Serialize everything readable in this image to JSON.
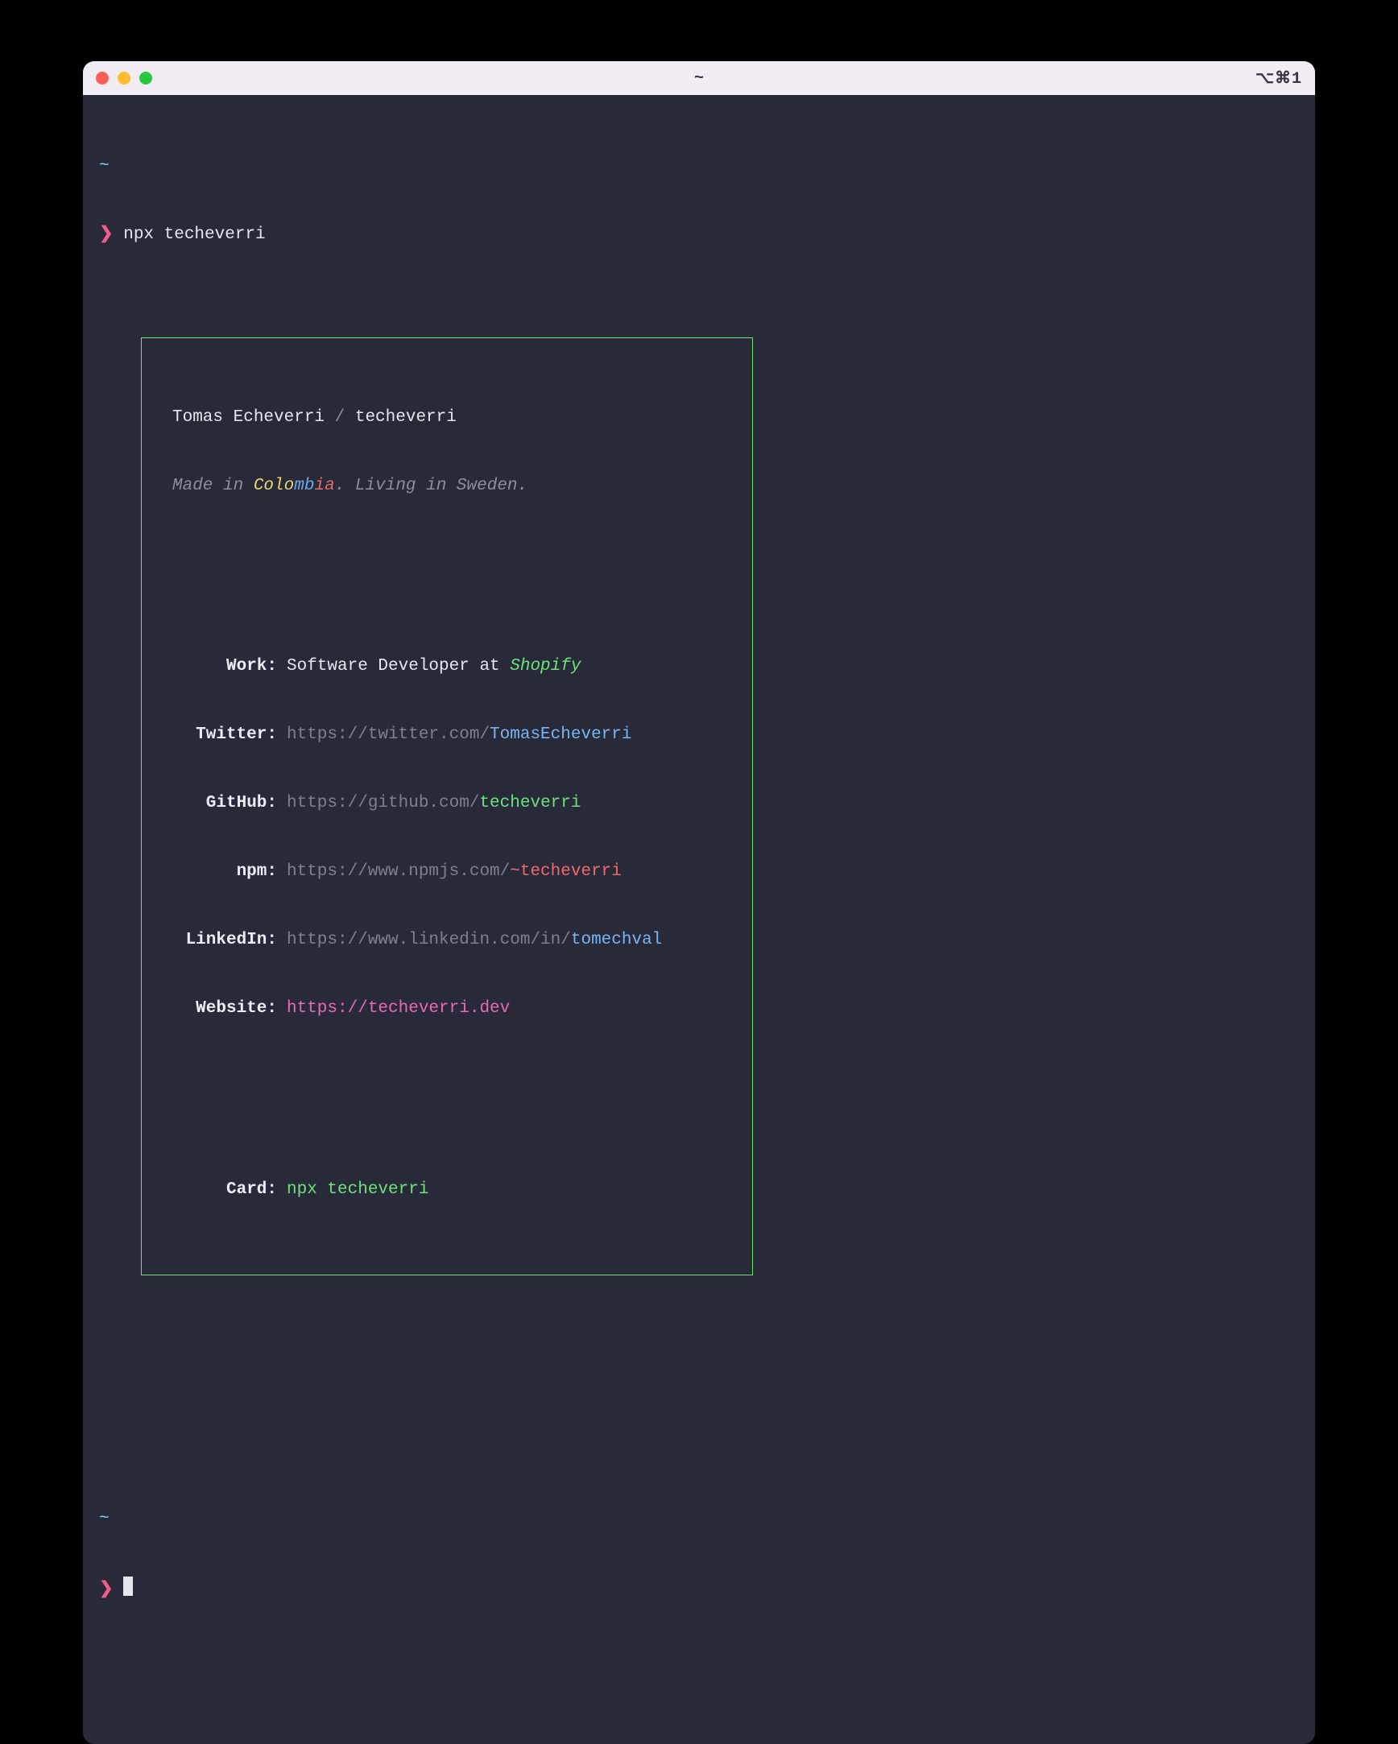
{
  "window": {
    "title": "~",
    "shortcut": "⌥⌘1"
  },
  "prompt": {
    "path_indicator": "~",
    "caret": "❯",
    "command": "npx techeverri"
  },
  "card": {
    "name": "Tomas Echeverri",
    "handle_sep": " / ",
    "handle": "techeverri",
    "tagline_prefix": "Made in ",
    "colombia": {
      "c1": "Colo",
      "c2": "mb",
      "c3": "ia"
    },
    "tagline_mid": ". ",
    "tagline_suffix": "Living in Sweden.",
    "rows": {
      "work": {
        "label": "Work:",
        "prefix": "Software Developer at ",
        "highlight": "Shopify"
      },
      "twitter": {
        "label": "Twitter:",
        "base": "https://twitter.com/",
        "highlight": "TomasEcheverri"
      },
      "github": {
        "label": "GitHub:",
        "base": "https://github.com/",
        "highlight": "techeverri"
      },
      "npm": {
        "label": "npm:",
        "base": "https://www.npmjs.com/",
        "highlight": "~techeverri"
      },
      "linkedin": {
        "label": "LinkedIn:",
        "base": "https://www.linkedin.com/in/",
        "highlight": "tomechval"
      },
      "website": {
        "label": "Website:",
        "highlight": "https://techeverri.dev"
      },
      "cardcmd": {
        "label": "Card:",
        "highlight": "npx techeverri"
      }
    }
  },
  "prompt2": {
    "path_indicator": "~",
    "caret": "❯"
  }
}
